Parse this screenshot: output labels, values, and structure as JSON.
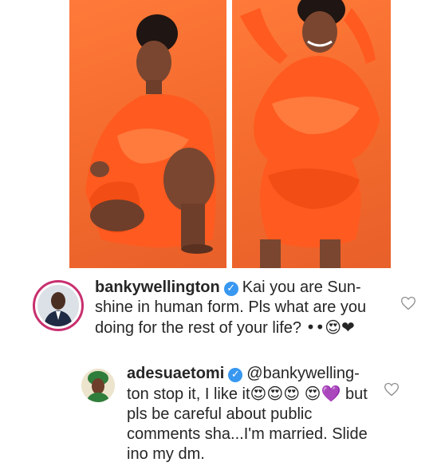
{
  "post": {
    "photos": [
      {
        "alt": "woman-in-orange-dress-crouching"
      },
      {
        "alt": "woman-in-orange-dress-standing"
      }
    ]
  },
  "comments": [
    {
      "username": "bankywellington",
      "text": "Kai you are Sun-shine in human form. Pls what are you doing for the rest of your life?",
      "emojis": "••😍❤",
      "verified": true
    },
    {
      "username": "adesuaetomi",
      "text_1": "@bankywelling-ton stop it, I like it",
      "emojis_1": "😍😍😍",
      "text_2": "but pls be careful about public comments sha...I'm married. Slide ino my dm.",
      "emojis_2": "😍💜",
      "verified": true
    }
  ],
  "colors": {
    "photo_background": "#f36a2c",
    "verified_badge": "#3897f0",
    "story_ring": "#c8306f"
  },
  "icons": {
    "verified": "verified-badge-icon",
    "like": "heart-outline-icon"
  }
}
